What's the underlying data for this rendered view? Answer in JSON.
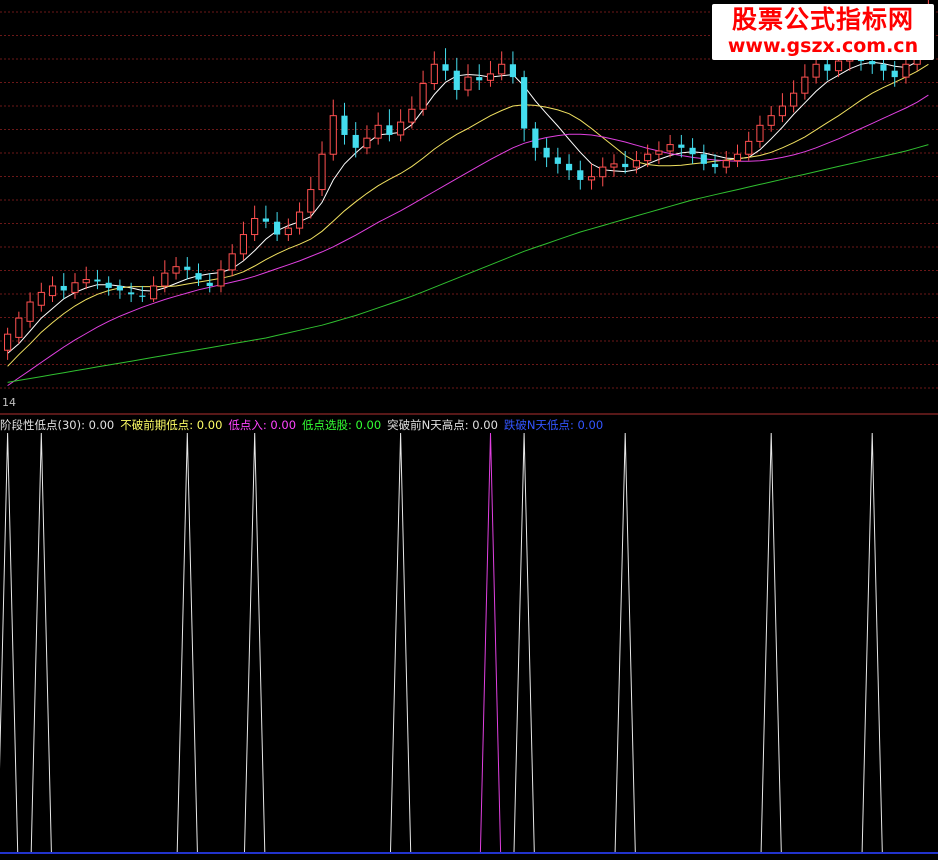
{
  "watermark": {
    "line1": "股票公式指标网",
    "line2": "www.gszx.com.cn"
  },
  "price_panel": {
    "axis_value_label": "14"
  },
  "indicator_legend": {
    "items": [
      {
        "label": "阶段性低点(30)",
        "value": "0.00",
        "color": "#e0e0e0"
      },
      {
        "label": "不破前期低点",
        "value": "0.00",
        "color": "#ffff66"
      },
      {
        "label": "低点入",
        "value": "0.00",
        "color": "#ff44ff"
      },
      {
        "label": "低点选股",
        "value": "0.00",
        "color": "#33ff33"
      },
      {
        "label": "突破前N天高点",
        "value": "0.00",
        "color": "#e0e0e0"
      },
      {
        "label": "跌破N天低点",
        "value": "0.00",
        "color": "#3355ff"
      }
    ]
  },
  "colors": {
    "background": "#000000",
    "grid": "#6b1818",
    "divider": "#b03030",
    "up": "#ff5050",
    "down": "#44ddee",
    "ma_white": "#ffffff",
    "ma_yellow": "#f0e060",
    "ma_magenta": "#e040e0",
    "ma_green": "#30c030",
    "signal_white": "#e8e8e8",
    "signal_magenta": "#e040e0",
    "bottom_axis": "#2233cc"
  },
  "chart_data": [
    {
      "type": "candlestick",
      "candles": [
        [
          12.05,
          12.3,
          12.4,
          11.9
        ],
        [
          12.25,
          12.55,
          12.65,
          12.15
        ],
        [
          12.5,
          12.8,
          12.95,
          12.4
        ],
        [
          12.75,
          12.95,
          13.1,
          12.65
        ],
        [
          12.9,
          13.05,
          13.2,
          12.8
        ],
        [
          13.05,
          12.98,
          13.25,
          12.85
        ],
        [
          12.95,
          13.1,
          13.25,
          12.85
        ],
        [
          13.1,
          13.15,
          13.35,
          13.0
        ],
        [
          13.15,
          13.12,
          13.3,
          13.0
        ],
        [
          13.1,
          13.02,
          13.2,
          12.9
        ],
        [
          13.05,
          12.98,
          13.15,
          12.85
        ],
        [
          12.95,
          12.92,
          13.1,
          12.8
        ],
        [
          12.9,
          12.88,
          13.05,
          12.8
        ],
        [
          12.85,
          13.05,
          13.2,
          12.8
        ],
        [
          13.05,
          13.25,
          13.45,
          12.95
        ],
        [
          13.25,
          13.35,
          13.5,
          13.15
        ],
        [
          13.35,
          13.3,
          13.5,
          13.15
        ],
        [
          13.25,
          13.15,
          13.4,
          13.05
        ],
        [
          13.1,
          13.05,
          13.25,
          12.95
        ],
        [
          13.05,
          13.3,
          13.45,
          12.95
        ],
        [
          13.3,
          13.55,
          13.7,
          13.2
        ],
        [
          13.55,
          13.85,
          14.05,
          13.45
        ],
        [
          13.85,
          14.1,
          14.3,
          13.75
        ],
        [
          14.1,
          14.05,
          14.3,
          13.95
        ],
        [
          14.05,
          13.85,
          14.2,
          13.75
        ],
        [
          13.85,
          13.95,
          14.1,
          13.75
        ],
        [
          13.95,
          14.2,
          14.35,
          13.85
        ],
        [
          14.2,
          14.55,
          14.75,
          14.1
        ],
        [
          14.55,
          15.1,
          15.3,
          14.45
        ],
        [
          15.1,
          15.7,
          15.95,
          15.0
        ],
        [
          15.7,
          15.4,
          15.9,
          15.25
        ],
        [
          15.4,
          15.2,
          15.6,
          15.05
        ],
        [
          15.2,
          15.35,
          15.55,
          15.1
        ],
        [
          15.35,
          15.55,
          15.75,
          15.25
        ],
        [
          15.55,
          15.4,
          15.8,
          15.3
        ],
        [
          15.4,
          15.6,
          15.8,
          15.3
        ],
        [
          15.6,
          15.8,
          16.0,
          15.5
        ],
        [
          15.8,
          16.2,
          16.4,
          15.7
        ],
        [
          16.2,
          16.5,
          16.7,
          16.1
        ],
        [
          16.5,
          16.4,
          16.75,
          16.25
        ],
        [
          16.4,
          16.1,
          16.6,
          15.95
        ],
        [
          16.1,
          16.3,
          16.5,
          16.0
        ],
        [
          16.3,
          16.25,
          16.5,
          16.1
        ],
        [
          16.25,
          16.35,
          16.55,
          16.15
        ],
        [
          16.35,
          16.5,
          16.7,
          16.25
        ],
        [
          16.5,
          16.3,
          16.7,
          16.2
        ],
        [
          16.3,
          15.5,
          16.4,
          15.3
        ],
        [
          15.5,
          15.2,
          15.6,
          15.0
        ],
        [
          15.2,
          15.05,
          15.35,
          14.9
        ],
        [
          15.05,
          14.95,
          15.2,
          14.8
        ],
        [
          14.95,
          14.85,
          15.1,
          14.7
        ],
        [
          14.85,
          14.7,
          15.0,
          14.55
        ],
        [
          14.7,
          14.75,
          14.95,
          14.55
        ],
        [
          14.75,
          14.9,
          15.05,
          14.6
        ],
        [
          14.9,
          14.95,
          15.1,
          14.75
        ],
        [
          14.95,
          14.9,
          15.15,
          14.8
        ],
        [
          14.9,
          15.0,
          15.15,
          14.8
        ],
        [
          15.0,
          15.1,
          15.25,
          14.9
        ],
        [
          15.1,
          15.15,
          15.3,
          14.95
        ],
        [
          15.15,
          15.25,
          15.4,
          15.05
        ],
        [
          15.25,
          15.2,
          15.4,
          15.05
        ],
        [
          15.2,
          15.1,
          15.35,
          14.95
        ],
        [
          15.1,
          14.95,
          15.25,
          14.85
        ],
        [
          14.95,
          14.9,
          15.1,
          14.8
        ],
        [
          14.9,
          15.0,
          15.15,
          14.8
        ],
        [
          15.0,
          15.1,
          15.25,
          14.9
        ],
        [
          15.1,
          15.3,
          15.45,
          15.0
        ],
        [
          15.3,
          15.55,
          15.7,
          15.2
        ],
        [
          15.55,
          15.7,
          15.85,
          15.45
        ],
        [
          15.7,
          15.85,
          16.05,
          15.6
        ],
        [
          15.85,
          16.05,
          16.25,
          15.75
        ],
        [
          16.05,
          16.3,
          16.5,
          15.95
        ],
        [
          16.3,
          16.5,
          16.7,
          16.2
        ],
        [
          16.5,
          16.4,
          16.7,
          16.25
        ],
        [
          16.4,
          16.55,
          16.75,
          16.3
        ],
        [
          16.55,
          16.6,
          16.8,
          16.4
        ],
        [
          16.6,
          16.55,
          16.8,
          16.4
        ],
        [
          16.55,
          16.5,
          16.7,
          16.35
        ],
        [
          16.5,
          16.4,
          16.65,
          16.25
        ],
        [
          16.4,
          16.3,
          16.55,
          16.15
        ],
        [
          16.3,
          16.5,
          16.65,
          16.2
        ],
        [
          16.5,
          16.95,
          17.15,
          16.4
        ],
        [
          16.95,
          17.3,
          17.5,
          16.85
        ]
      ],
      "ma_series": [
        {
          "name": "MA5",
          "color_key": "ma_white",
          "values": [
            12.0,
            12.15,
            12.35,
            12.55,
            12.7,
            12.85,
            12.95,
            13.02,
            13.07,
            13.07,
            13.05,
            13.02,
            12.98,
            12.97,
            13.02,
            13.09,
            13.16,
            13.21,
            13.24,
            13.26,
            13.32,
            13.44,
            13.6,
            13.78,
            13.91,
            13.99,
            14.05,
            14.13,
            14.35,
            14.7,
            14.95,
            15.12,
            15.27,
            15.4,
            15.42,
            15.44,
            15.56,
            15.79,
            16.03,
            16.22,
            16.32,
            16.34,
            16.33,
            16.3,
            16.32,
            16.34,
            16.16,
            15.93,
            15.73,
            15.54,
            15.33,
            15.13,
            14.95,
            14.86,
            14.84,
            14.83,
            14.86,
            14.95,
            15.02,
            15.08,
            15.12,
            15.14,
            15.12,
            15.08,
            15.04,
            15.03,
            15.05,
            15.17,
            15.34,
            15.52,
            15.72,
            15.9,
            16.08,
            16.23,
            16.33,
            16.43,
            16.5,
            16.53,
            16.51,
            16.47,
            16.45,
            16.54,
            16.75
          ]
        },
        {
          "name": "MA10",
          "color_key": "ma_yellow",
          "values": [
            11.8,
            11.98,
            12.15,
            12.33,
            12.48,
            12.62,
            12.74,
            12.84,
            12.92,
            12.98,
            13.02,
            13.04,
            13.04,
            13.04,
            13.04,
            13.05,
            13.08,
            13.11,
            13.14,
            13.17,
            13.21,
            13.27,
            13.36,
            13.46,
            13.55,
            13.63,
            13.7,
            13.78,
            13.9,
            14.06,
            14.22,
            14.36,
            14.49,
            14.61,
            14.71,
            14.8,
            14.91,
            15.04,
            15.18,
            15.3,
            15.41,
            15.5,
            15.6,
            15.7,
            15.78,
            15.85,
            15.87,
            15.86,
            15.83,
            15.79,
            15.73,
            15.63,
            15.5,
            15.36,
            15.22,
            15.08,
            14.98,
            14.94,
            14.92,
            14.92,
            14.93,
            14.95,
            14.97,
            14.99,
            15.01,
            15.03,
            15.05,
            15.08,
            15.13,
            15.2,
            15.28,
            15.37,
            15.48,
            15.59,
            15.7,
            15.82,
            15.94,
            16.05,
            16.14,
            16.22,
            16.3,
            16.39,
            16.5
          ]
        },
        {
          "name": "MA20",
          "color_key": "ma_magenta",
          "values": [
            11.5,
            11.62,
            11.74,
            11.86,
            11.98,
            12.1,
            12.21,
            12.31,
            12.41,
            12.5,
            12.58,
            12.65,
            12.72,
            12.78,
            12.84,
            12.89,
            12.94,
            12.99,
            13.03,
            13.07,
            13.11,
            13.15,
            13.2,
            13.26,
            13.32,
            13.38,
            13.44,
            13.51,
            13.58,
            13.66,
            13.75,
            13.84,
            13.94,
            14.04,
            14.13,
            14.22,
            14.32,
            14.42,
            14.52,
            14.62,
            14.72,
            14.82,
            14.92,
            15.02,
            15.11,
            15.2,
            15.27,
            15.32,
            15.36,
            15.39,
            15.41,
            15.41,
            15.4,
            15.37,
            15.33,
            15.29,
            15.24,
            15.19,
            15.15,
            15.11,
            15.08,
            15.05,
            15.03,
            15.01,
            15.0,
            14.99,
            14.99,
            15.0,
            15.02,
            15.05,
            15.09,
            15.14,
            15.2,
            15.27,
            15.34,
            15.42,
            15.5,
            15.58,
            15.66,
            15.74,
            15.82,
            15.91,
            16.02
          ]
        },
        {
          "name": "MA60",
          "color_key": "ma_green",
          "values": [
            11.55,
            11.58,
            11.61,
            11.64,
            11.67,
            11.7,
            11.73,
            11.76,
            11.79,
            11.82,
            11.85,
            11.88,
            11.91,
            11.94,
            11.97,
            12.0,
            12.03,
            12.06,
            12.09,
            12.12,
            12.15,
            12.18,
            12.21,
            12.24,
            12.28,
            12.32,
            12.36,
            12.4,
            12.44,
            12.49,
            12.54,
            12.59,
            12.65,
            12.71,
            12.77,
            12.83,
            12.89,
            12.96,
            13.03,
            13.1,
            13.17,
            13.24,
            13.31,
            13.38,
            13.45,
            13.52,
            13.59,
            13.65,
            13.71,
            13.77,
            13.83,
            13.89,
            13.94,
            13.99,
            14.04,
            14.09,
            14.14,
            14.19,
            14.24,
            14.29,
            14.34,
            14.39,
            14.43,
            14.47,
            14.51,
            14.55,
            14.59,
            14.63,
            14.67,
            14.71,
            14.75,
            14.79,
            14.83,
            14.87,
            14.91,
            14.95,
            14.99,
            15.03,
            15.07,
            15.11,
            15.15,
            15.2,
            15.25
          ]
        }
      ],
      "y_range": [
        11.4,
        17.5
      ],
      "grid": true
    },
    {
      "type": "line",
      "series": [
        {
          "color_key": "signal_white",
          "spikes_at_bar": [
            0,
            3,
            16,
            22,
            35,
            46,
            55,
            68,
            77
          ]
        },
        {
          "color_key": "signal_magenta",
          "spikes_at_bar": [
            43
          ]
        }
      ],
      "y_range": [
        0,
        1
      ],
      "grid": false
    }
  ]
}
